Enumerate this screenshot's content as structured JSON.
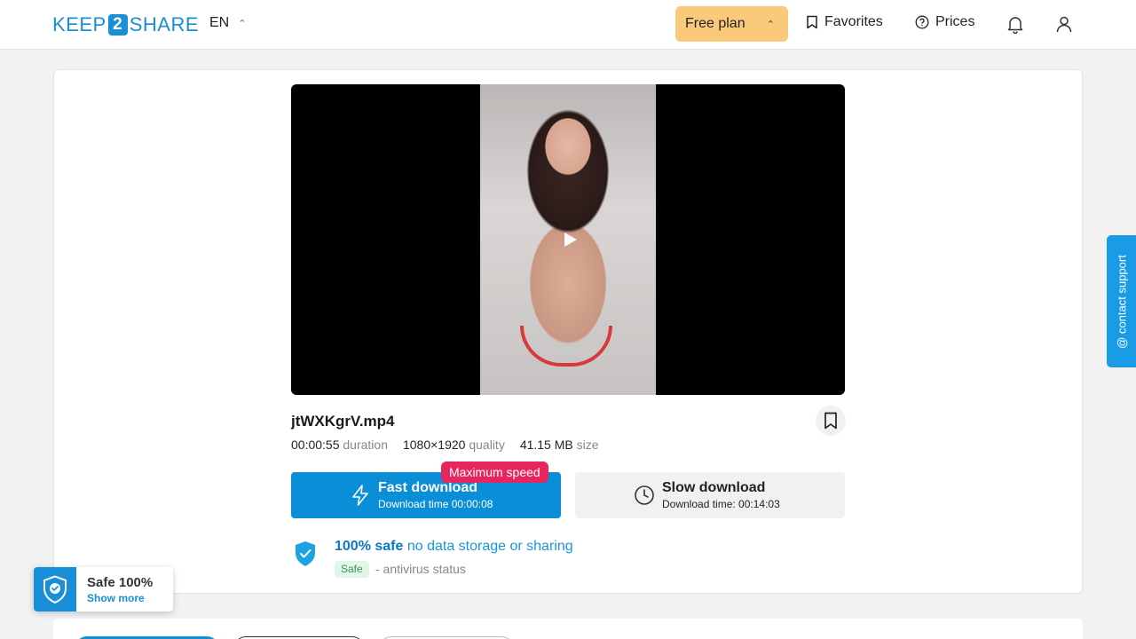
{
  "header": {
    "logo_left": "KEEP",
    "logo_num": "2",
    "logo_right": "SHARE",
    "language": "EN",
    "plan_label": "Free plan",
    "favorites_label": "Favorites",
    "prices_label": "Prices"
  },
  "file": {
    "name": "jtWXKgrV.mp4",
    "duration_value": "00:00:55",
    "duration_label": "duration",
    "quality_value": "1080×1920",
    "quality_label": "quality",
    "size_value": "41.15 MB",
    "size_label": "size"
  },
  "downloads": {
    "badge": "Maximum speed",
    "fast_title": "Fast download",
    "fast_sub": "Download time 00:00:08",
    "slow_title": "Slow download",
    "slow_sub": "Download time: 00:14:03"
  },
  "safety": {
    "strong": "100% safe",
    "light": "no data storage or sharing",
    "tag": "Safe",
    "status": "- antivirus status"
  },
  "contact_support": "@ contact support",
  "safe_widget": {
    "title": "Safe 100%",
    "link": "Show more"
  },
  "colors": {
    "accent": "#0a8ed8",
    "plan": "#fbc97a",
    "badge": "#e6265c"
  }
}
